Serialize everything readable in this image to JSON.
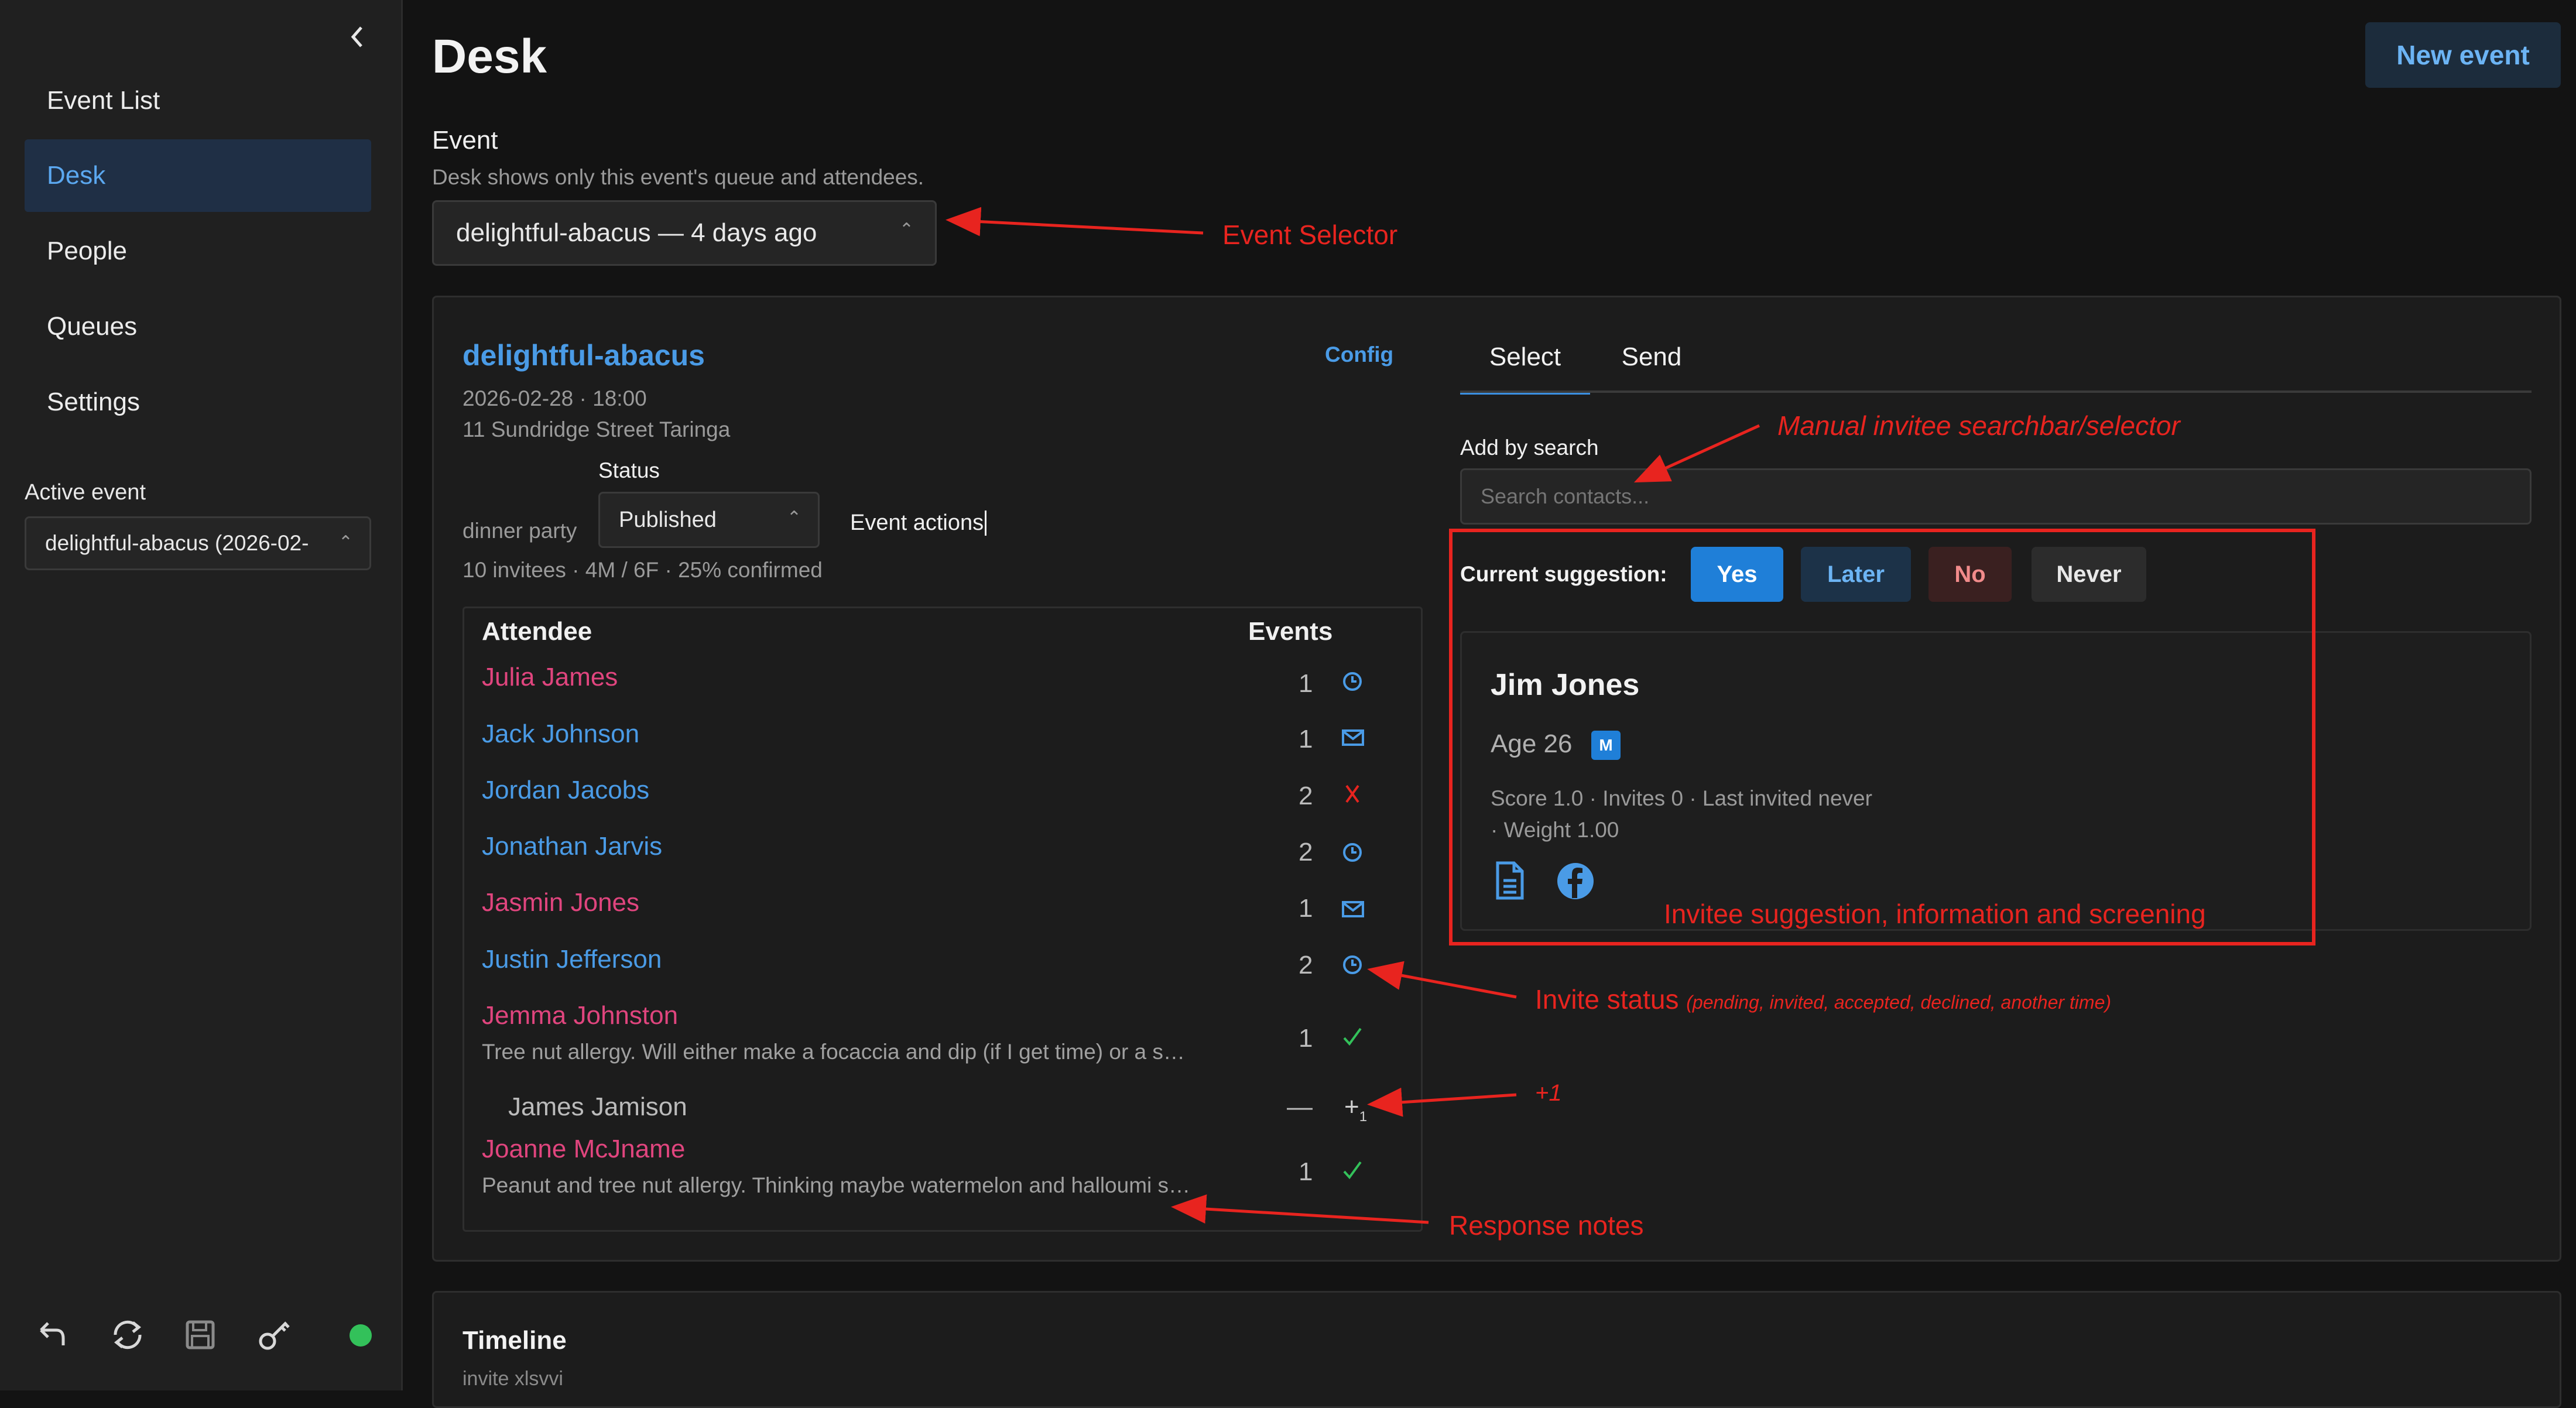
{
  "colors": {
    "accent": "#1f7fd8",
    "link": "#4a9be6",
    "pink_name": "#e0457e",
    "annotation": "#e8241f",
    "status_ok": "#33c15a"
  },
  "sidebar": {
    "collapse_icon": "chevron-left-icon",
    "items": [
      {
        "label": "Event List"
      },
      {
        "label": "Desk",
        "active": true
      },
      {
        "label": "People"
      },
      {
        "label": "Queues"
      },
      {
        "label": "Settings"
      }
    ],
    "active_event_label": "Active event",
    "active_event_value": "delightful-abacus (2026-02-",
    "footer_icons": [
      "undo-icon",
      "sync-icon",
      "save-icon",
      "key-icon",
      "status-dot-icon"
    ]
  },
  "header": {
    "title": "Desk",
    "new_event_label": "New event"
  },
  "event_section": {
    "label": "Event",
    "help": "Desk shows only this event's queue and attendees.",
    "selected": "delightful-abacus — 4 days ago"
  },
  "event_card": {
    "name": "delightful-abacus",
    "config_label": "Config",
    "datetime": "2026-02-28 · 18:00",
    "address": "11 Sundridge Street Taringa",
    "type": "dinner party",
    "status_label": "Status",
    "status_value": "Published",
    "actions_label": "Event actions",
    "summary": "10 invitees · 4M / 6F · 25% confirmed",
    "table_headers": {
      "attendee": "Attendee",
      "events": "Events"
    },
    "attendees": [
      {
        "name": "Julia James",
        "count": "1",
        "status": "clock-icon"
      },
      {
        "name": "Jack Johnson",
        "count": "1",
        "status": "mail-icon"
      },
      {
        "name": "Jordan Jacobs",
        "count": "2",
        "status": "cross-icon"
      },
      {
        "name": "Jonathan Jarvis",
        "count": "2",
        "status": "clock-icon"
      },
      {
        "name": "Jasmin Jones",
        "count": "1",
        "status": "mail-icon"
      },
      {
        "name": "Justin Jefferson",
        "count": "2",
        "status": "clock-icon"
      },
      {
        "name": "Jemma Johnston",
        "count": "1",
        "status": "check-icon",
        "note": "Tree nut allergy. Will either make a focaccia and dip (if I get time) or a s…"
      },
      {
        "name": "James Jamison",
        "count": "—",
        "status": "plus-one-icon",
        "plus_label": "+",
        "plus_sub": "1"
      },
      {
        "name": "Joanne McJname",
        "count": "1",
        "status": "check-icon",
        "note": "Peanut and tree nut allergy. Thinking maybe watermelon and halloumi s…"
      }
    ]
  },
  "right_pane": {
    "tabs": [
      {
        "label": "Select",
        "active": true
      },
      {
        "label": "Send"
      }
    ],
    "add_by_search_label": "Add by search",
    "search_placeholder": "Search contacts...",
    "suggestion_label": "Current suggestion:",
    "buttons": {
      "yes": "Yes",
      "later": "Later",
      "no": "No",
      "never": "Never"
    },
    "candidate": {
      "name": "Jim Jones",
      "age": "Age 26",
      "gender_badge": "M",
      "stats_line1": "Score 1.0 · Invites 0 · Last invited never",
      "stats_line2": "· Weight 1.00",
      "icons": [
        "document-icon",
        "facebook-icon"
      ]
    }
  },
  "timeline": {
    "title": "Timeline",
    "partial_text": "invite   xlsvvi"
  },
  "annotations": {
    "event_selector": "Event Selector",
    "manual_search": "Manual invitee searchbar/selector",
    "suggestion_box": "Invitee suggestion, information and screening",
    "invite_status": "Invite status",
    "invite_status_detail": "(pending, invited, accepted, declined, another time)",
    "plus_one": "+1",
    "response_notes": "Response notes"
  }
}
